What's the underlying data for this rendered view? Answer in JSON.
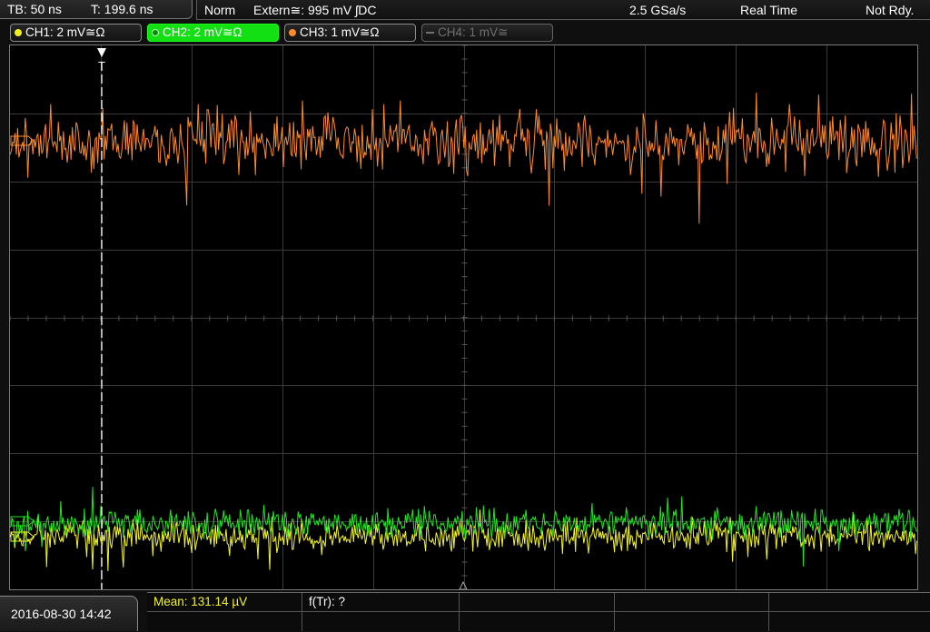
{
  "topbar": {
    "timebase": "TB: 50 ns",
    "trigger_time": "T: 199.6 ns",
    "mode": "Norm",
    "trigger_source": "Extern≅: 995 mV ʃDC",
    "sample_rate": "2.5 GSa/s",
    "acq_mode": "Real Time",
    "status": "Not Rdy."
  },
  "channels": [
    {
      "label": "CH1: 2 mV≅Ω",
      "color": "#f0f020",
      "state": "on"
    },
    {
      "label": "CH2: 2 mV≅Ω",
      "color": "#20ff20",
      "state": "active"
    },
    {
      "label": "CH3: 1 mV≅Ω",
      "color": "#ff8a2a",
      "state": "on"
    },
    {
      "label": "CH4: 1 mV≅",
      "color": "#707070",
      "state": "off"
    }
  ],
  "trigger_marker": "T",
  "bottom": {
    "datetime": "2016-08-30 14:42",
    "measurement_mean": "Mean: 131.14 µV",
    "measurement_freq": "f(Tr): ?"
  },
  "colors": {
    "ch1": "#f5f522",
    "ch2": "#22e622",
    "ch3": "#ff8a2a",
    "grid": "#3a3a3a",
    "mean_text": "#f5f522"
  }
}
